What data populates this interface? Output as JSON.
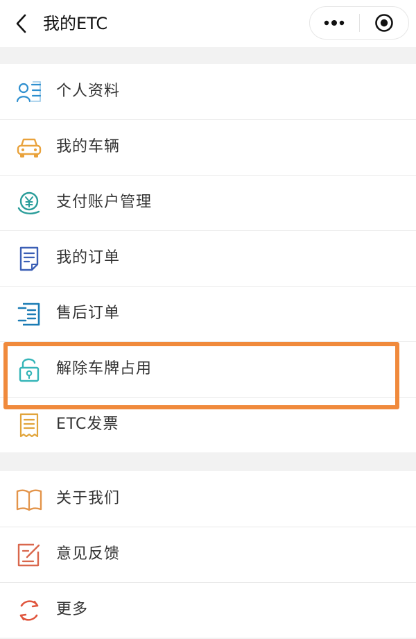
{
  "header": {
    "title": "我的ETC",
    "back_icon": "chevron-left-icon",
    "more_icon": "more-dots-icon",
    "close_icon": "target-circle-icon"
  },
  "menu_groups": [
    {
      "items": [
        {
          "label": "个人资料",
          "icon": "id-card-icon",
          "color": "#2e8fcf"
        },
        {
          "label": "我的车辆",
          "icon": "car-icon",
          "color": "#e9a23b"
        },
        {
          "label": "支付账户管理",
          "icon": "yuan-coin-icon",
          "color": "#2a9d9a"
        },
        {
          "label": "我的订单",
          "icon": "document-icon",
          "color": "#3b5fb5"
        },
        {
          "label": "售后订单",
          "icon": "list-icon",
          "color": "#1b7cb5"
        },
        {
          "label": "解除车牌占用",
          "icon": "unlock-icon",
          "color": "#35b5b8"
        },
        {
          "label": "ETC发票",
          "icon": "receipt-icon",
          "color": "#e1a43a"
        }
      ]
    },
    {
      "items": [
        {
          "label": "关于我们",
          "icon": "book-icon",
          "color": "#e3944a"
        },
        {
          "label": "意见反馈",
          "icon": "edit-icon",
          "color": "#d9674c"
        },
        {
          "label": "更多",
          "icon": "refresh-icon",
          "color": "#e0553d"
        }
      ]
    }
  ],
  "highlight": {
    "target": "解除车牌占用",
    "color": "#f08a3c"
  }
}
